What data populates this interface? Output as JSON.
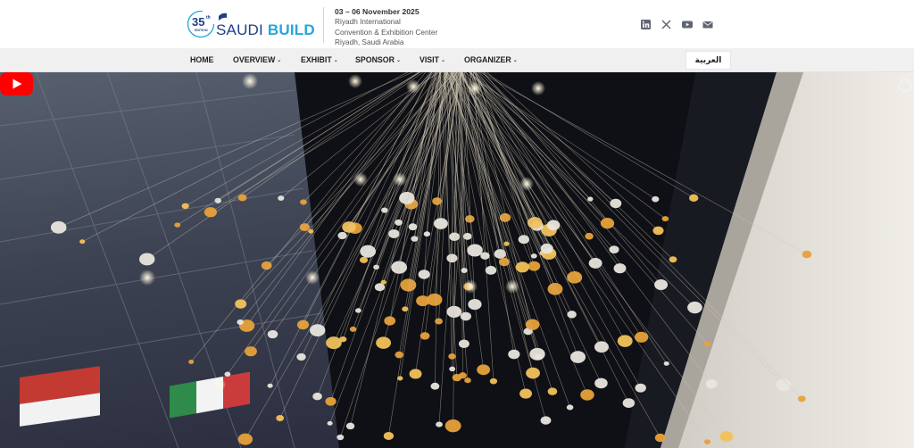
{
  "brand": {
    "edition_number": "35",
    "edition_suffix": "th",
    "edition_label": "EDITION",
    "name_part1": "SAUDI",
    "name_part2": "BUILD",
    "colors": {
      "navy": "#1e3f87",
      "sky": "#27a6d9"
    }
  },
  "event": {
    "date": "03 – 06 November 2025",
    "venue_line1": "Riyadh International",
    "venue_line2": "Convention & Exhibition Center",
    "venue_line3": "Riyadh, Saudi Arabia"
  },
  "socials": [
    "linkedin-icon",
    "x-icon",
    "youtube-icon",
    "email-icon"
  ],
  "nav": {
    "items": [
      {
        "label": "HOME",
        "has_dropdown": false
      },
      {
        "label": "OVERVIEW",
        "has_dropdown": true
      },
      {
        "label": "EXHIBIT",
        "has_dropdown": true
      },
      {
        "label": "SPONSOR",
        "has_dropdown": true
      },
      {
        "label": "VISIT",
        "has_dropdown": true
      },
      {
        "label": "ORGANIZER",
        "has_dropdown": true
      }
    ],
    "caret": "⌄",
    "language_button": "العربية"
  },
  "video": {
    "play_color": "#ff0000"
  }
}
